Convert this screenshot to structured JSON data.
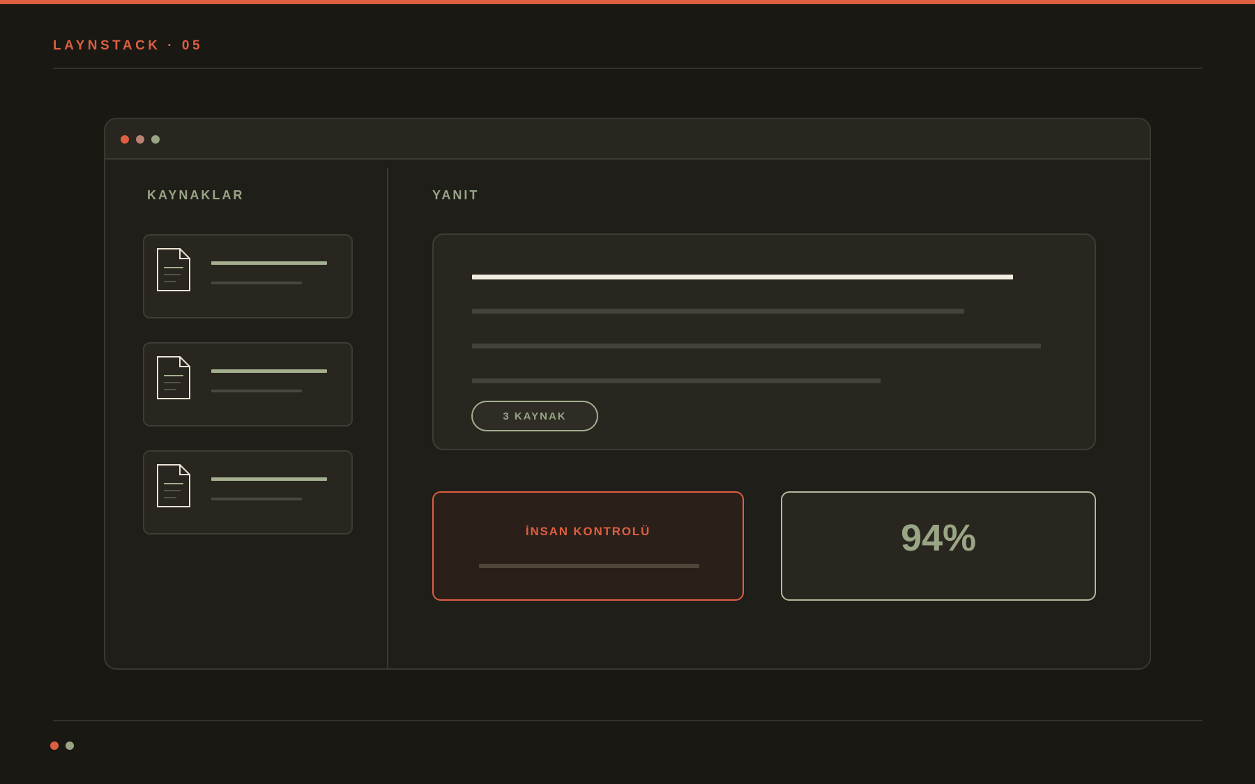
{
  "header": {
    "brand": "LAYNSTACK · 05",
    "accent_color": "#dd5f40"
  },
  "window": {
    "controls": [
      "close-dot",
      "minimize-dot",
      "maximize-dot"
    ],
    "sources_panel": {
      "title": "KAYNAKLAR",
      "items": [
        {
          "icon": "document-icon"
        },
        {
          "icon": "document-icon"
        },
        {
          "icon": "document-icon"
        }
      ]
    },
    "answer_panel": {
      "title": "YANIT",
      "source_count_badge": "3 KAYNAK",
      "human_review": {
        "label": "İNSAN KONTROLÜ",
        "color": "#dd5f40"
      },
      "confidence": {
        "value": "94%",
        "color": "#99a585"
      }
    }
  },
  "footer": {
    "indicators": [
      "orange-dot",
      "green-dot"
    ]
  }
}
